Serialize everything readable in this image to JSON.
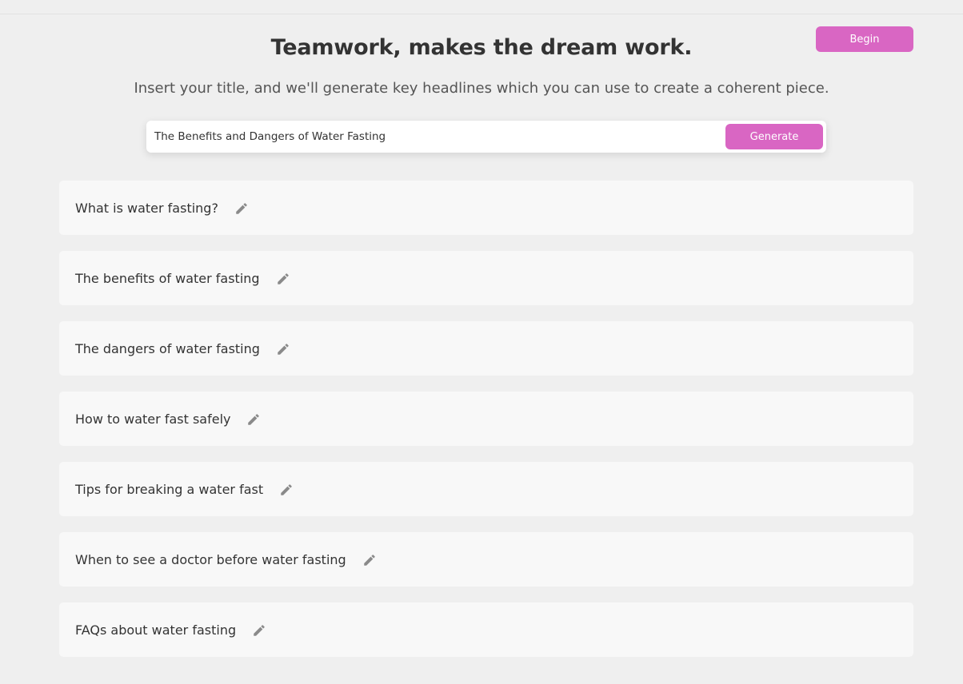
{
  "header": {
    "title": "Teamwork, makes the dream work.",
    "subtitle": "Insert your title, and we'll generate key headlines which you can use to create a coherent piece.",
    "begin_label": "Begin"
  },
  "search": {
    "value": "The Benefits and Dangers of Water Fasting",
    "generate_label": "Generate"
  },
  "headlines": [
    {
      "text": "What is water fasting?",
      "icon": "pencil-icon"
    },
    {
      "text": "The benefits of water fasting",
      "icon": "pencil-icon"
    },
    {
      "text": "The dangers of water fasting",
      "icon": "pencil-icon"
    },
    {
      "text": "How to water fast safely",
      "icon": "pencil-icon"
    },
    {
      "text": "Tips for breaking a water fast",
      "icon": "pencil-icon"
    },
    {
      "text": "When to see a doctor before water fasting",
      "icon": "pencil-icon"
    },
    {
      "text": "FAQs about water fasting",
      "icon": "pencil-icon"
    }
  ],
  "colors": {
    "accent": "#d966c3",
    "background": "#efefef",
    "card": "#f8f8f8",
    "icon": "#8a8a8a"
  }
}
